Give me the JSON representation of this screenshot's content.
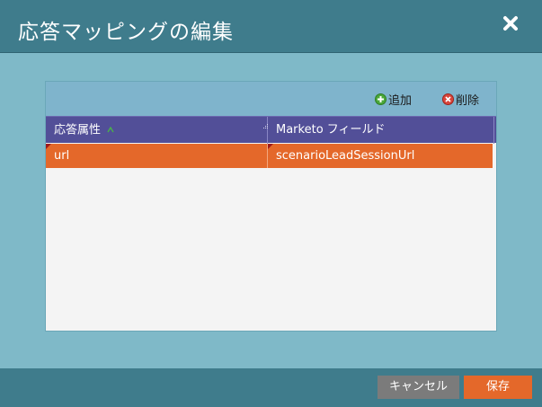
{
  "dialog": {
    "title": "応答マッピングの編集"
  },
  "toolbar": {
    "add_label": "追加",
    "delete_label": "削除"
  },
  "grid": {
    "columns": [
      "応答属性",
      "Marketo フィールド"
    ],
    "rows": [
      [
        "url",
        "scenarioLeadSessionUrl"
      ]
    ]
  },
  "footer": {
    "cancel_label": "キャンセル",
    "save_label": "保存"
  },
  "colors": {
    "titlebar": "#3f7c8c",
    "header": "#524f98",
    "selected_row": "#e4682a",
    "save_button": "#e4682a",
    "cancel_button": "#7b7b7b"
  },
  "icons": [
    "close-icon",
    "add-icon",
    "delete-icon",
    "sort-icon",
    "column-resize-icon"
  ]
}
